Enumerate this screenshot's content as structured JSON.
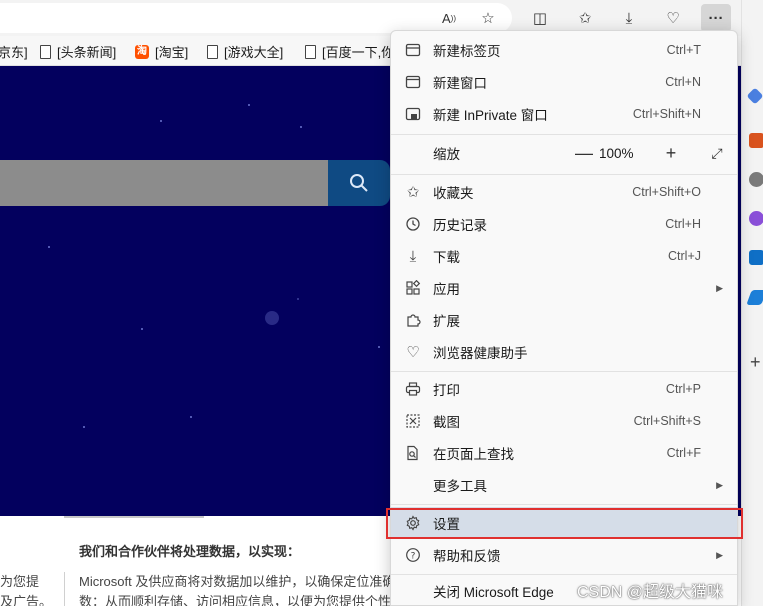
{
  "toolbar": {
    "buttons": [
      {
        "name": "read-aloud",
        "glyph": "Ȃ"
      },
      {
        "name": "favorite-star",
        "glyph": "☆"
      },
      {
        "name": "split-screen",
        "glyph": "◫"
      },
      {
        "name": "favorites",
        "glyph": "✩"
      },
      {
        "name": "downloads",
        "glyph": "⤓"
      },
      {
        "name": "browser-essentials",
        "glyph": "♡"
      },
      {
        "name": "settings-and-more",
        "glyph": "···"
      }
    ]
  },
  "favorites_bar": {
    "items": [
      {
        "label": "京东]"
      },
      {
        "label": "[头条新闻]"
      },
      {
        "label": "[淘宝]",
        "icon_text": "淘"
      },
      {
        "label": "[游戏大全]"
      },
      {
        "label": "[百度一下,你"
      }
    ]
  },
  "page": {
    "privacy_title": "我们和合作伙伴将处理数据，以实现：",
    "privacy_line1": "Microsoft 及供应商将对数据加以维护，以确保定位准确",
    "privacy_line2": "数：从而顺利存储、访问相应信息，以便为您提供个性",
    "left_line1": "为您提",
    "left_line2": "及广告。"
  },
  "menu": {
    "new_tab": {
      "label": "新建标签页",
      "shortcut": "Ctrl+T"
    },
    "new_window": {
      "label": "新建窗口",
      "shortcut": "Ctrl+N"
    },
    "new_inprivate": {
      "label": "新建 InPrivate 窗口",
      "shortcut": "Ctrl+Shift+N"
    },
    "zoom": {
      "label": "缩放",
      "minus": "—",
      "value": "100%",
      "plus": "+",
      "fullscreen": "⤢"
    },
    "favorites": {
      "label": "收藏夹",
      "shortcut": "Ctrl+Shift+O"
    },
    "history": {
      "label": "历史记录",
      "shortcut": "Ctrl+H"
    },
    "downloads": {
      "label": "下载",
      "shortcut": "Ctrl+J"
    },
    "apps": {
      "label": "应用"
    },
    "extensions": {
      "label": "扩展"
    },
    "browser_health": {
      "label": "浏览器健康助手"
    },
    "print": {
      "label": "打印",
      "shortcut": "Ctrl+P"
    },
    "screenshot": {
      "label": "截图",
      "shortcut": "Ctrl+Shift+S"
    },
    "find_on_page": {
      "label": "在页面上查找",
      "shortcut": "Ctrl+F"
    },
    "more_tools": {
      "label": "更多工具"
    },
    "settings": {
      "label": "设置"
    },
    "help_feedback": {
      "label": "帮助和反馈"
    },
    "close_edge": {
      "label": "关闭 Microsoft Edge"
    }
  },
  "watermark": "CSDN @超级大猫咪",
  "colors": {
    "hero_bg": "#03005e",
    "highlight": "#e0302f",
    "settings_row": "#d5dde8"
  }
}
